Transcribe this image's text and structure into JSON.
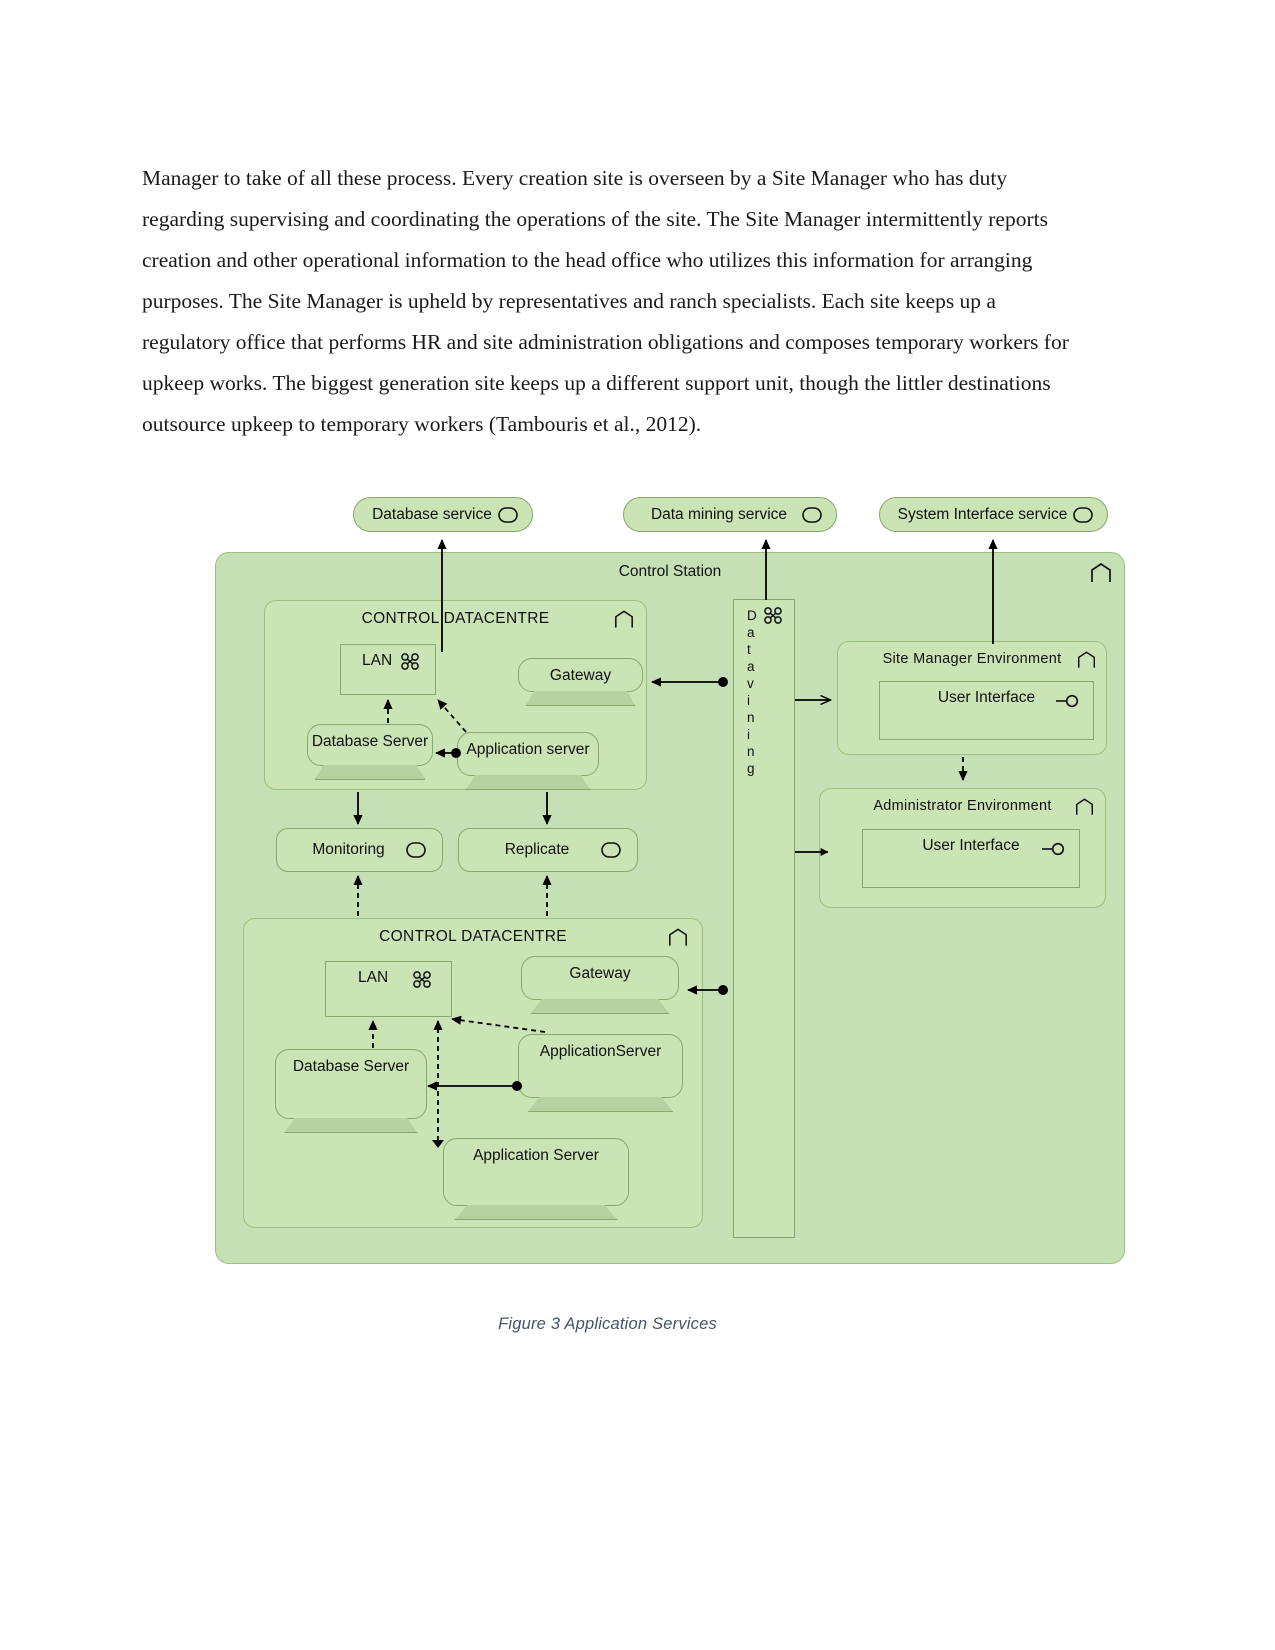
{
  "document": {
    "paragraph": "Manager to take of all these process. Every creation site is overseen by a Site Manager who has duty regarding supervising and coordinating the operations of the site. The Site Manager intermittently reports creation and other operational information to the head office who utilizes this information for arranging purposes. The Site Manager is upheld by representatives and ranch specialists. Each site keeps up a regulatory office that performs HR and site administration obligations and composes temporary workers for upkeep works. The biggest generation site keeps up a different support unit, though the littler destinations outsource upkeep to temporary workers (Tambouris et al., 2012).",
    "figure_caption": "Figure 3 Application Services"
  },
  "colors": {
    "panel_fill": "#c5e0b4",
    "node_fill": "#cbe4b6",
    "border": "#86a86a",
    "panel_border": "#9cc07c",
    "stand_fill": "#b6d2a0",
    "line": "#000000",
    "caption_text": "#44546a",
    "body_text": "#1a1a1a"
  },
  "diagram": {
    "title": "Application Services",
    "external_services": [
      {
        "label": "Database service",
        "icon": "service-icon"
      },
      {
        "label": "Data mining service",
        "icon": "service-icon"
      },
      {
        "label": "System Interface service",
        "icon": "service-icon"
      }
    ],
    "control_station": {
      "label": "Control Station",
      "icon": "node-icon"
    },
    "upper_datacentre": {
      "label": "CONTROL DATACENTRE",
      "icon": "node-icon",
      "lan": {
        "label": "LAN",
        "icon": "network-icon"
      },
      "gateway": {
        "label": "Gateway",
        "icon": "device-icon"
      },
      "database_server": {
        "label": "Database Server",
        "icon": "device-icon"
      },
      "application_server": {
        "label": "Application server",
        "icon": "device-icon"
      }
    },
    "middle_services": [
      {
        "label": "Monitoring",
        "icon": "service-icon"
      },
      {
        "label": "Replicate",
        "icon": "service-icon"
      }
    ],
    "lower_datacentre": {
      "label": "CONTROL DATACENTRE",
      "icon": "node-icon",
      "lan": {
        "label": "LAN",
        "icon": "network-icon"
      },
      "gateway": {
        "label": "Gateway",
        "icon": "device-icon"
      },
      "database_server": {
        "label": "Database Server",
        "icon": "device-icon"
      },
      "application_server_1": {
        "label": "ApplicationServer",
        "icon": "device-icon"
      },
      "application_server_2": {
        "label": "Application Server",
        "icon": "device-icon"
      }
    },
    "data_mining_column": {
      "label": "Data vining",
      "letters": [
        "D",
        "a",
        "t",
        "a",
        "v",
        "i",
        "n",
        "i",
        "n",
        "g"
      ],
      "icon": "network-icon"
    },
    "site_manager_environment": {
      "label": "Site Manager Environment",
      "icon": "node-icon",
      "user_interface": {
        "label": "User Interface",
        "icon": "interface-icon"
      }
    },
    "administrator_environment": {
      "label": "Administrator Environment",
      "icon": "node-icon",
      "user_interface": {
        "label": "User Interface",
        "icon": "interface-icon"
      }
    }
  }
}
